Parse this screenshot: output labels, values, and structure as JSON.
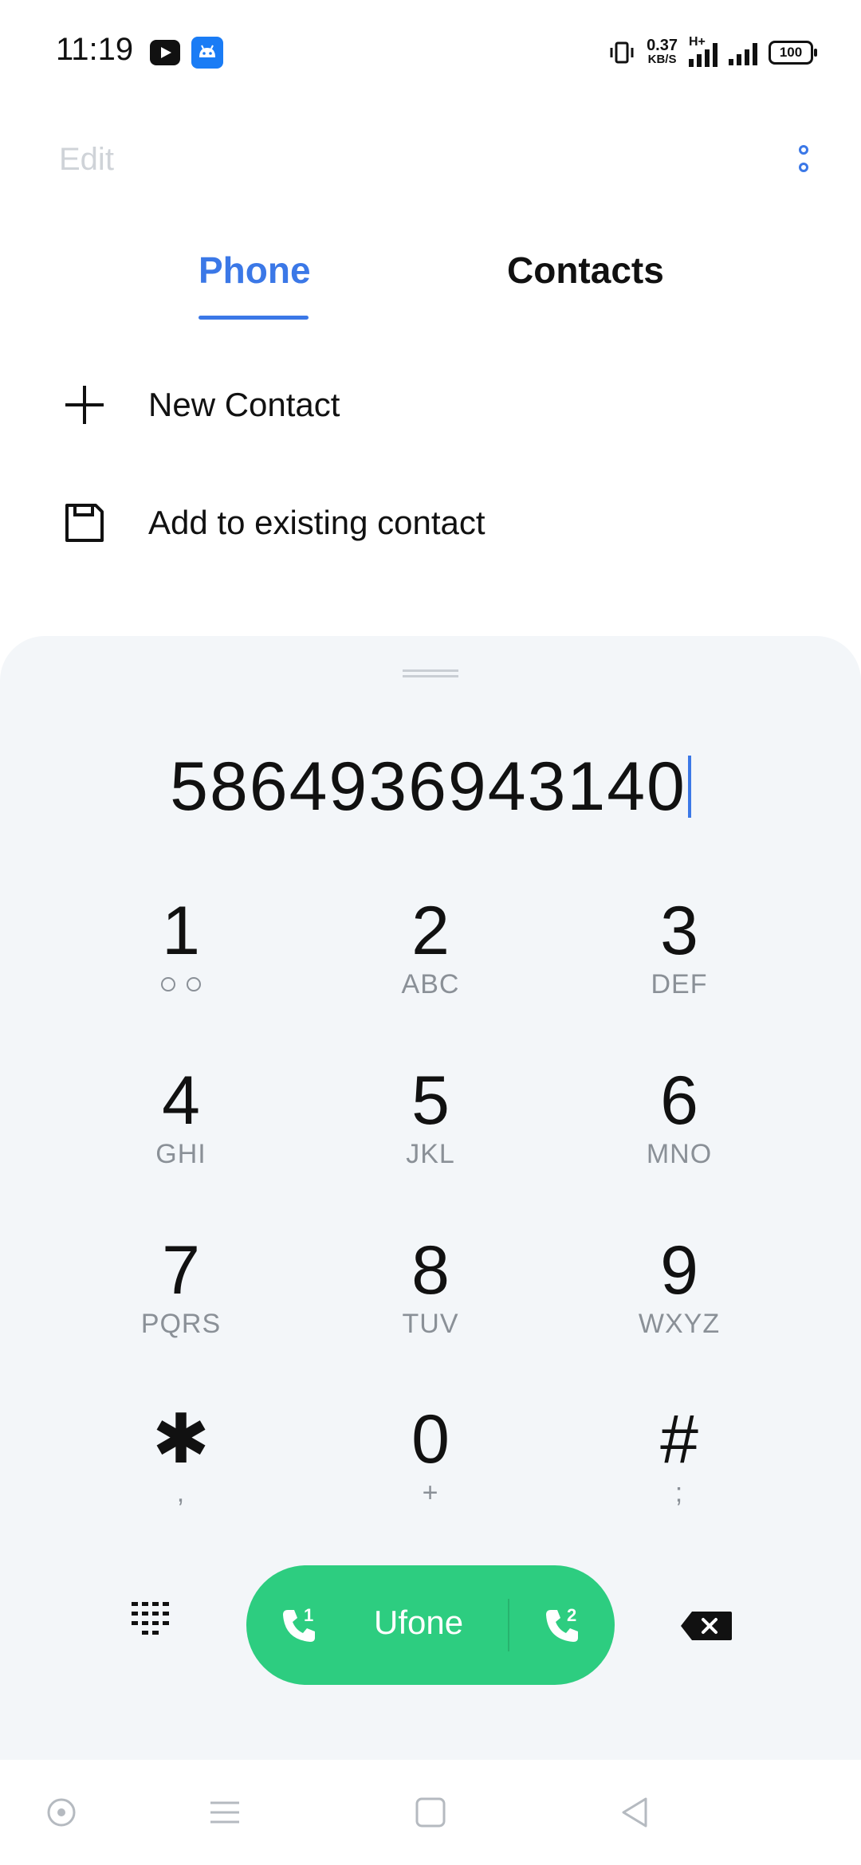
{
  "status_bar": {
    "time": "11:19",
    "speed_value": "0.37",
    "speed_unit": "KB/S",
    "network": "H+",
    "battery": "100",
    "app_icons": [
      "youtube-icon",
      "android-icon"
    ]
  },
  "header": {
    "edit_label": "Edit",
    "more_icon": "more-vertical-icon"
  },
  "tabs": [
    {
      "label": "Phone",
      "active": true
    },
    {
      "label": "Contacts",
      "active": false
    }
  ],
  "actions": [
    {
      "label": "New Contact",
      "icon": "plus-icon"
    },
    {
      "label": "Add to existing contact",
      "icon": "save-icon"
    }
  ],
  "dialer": {
    "number": "5864936943140",
    "keys": [
      {
        "digit": "1",
        "sub": ""
      },
      {
        "digit": "2",
        "sub": "ABC"
      },
      {
        "digit": "3",
        "sub": "DEF"
      },
      {
        "digit": "4",
        "sub": "GHI"
      },
      {
        "digit": "5",
        "sub": "JKL"
      },
      {
        "digit": "6",
        "sub": "MNO"
      },
      {
        "digit": "7",
        "sub": "PQRS"
      },
      {
        "digit": "8",
        "sub": "TUV"
      },
      {
        "digit": "9",
        "sub": "WXYZ"
      },
      {
        "digit": "✱",
        "sub": ","
      },
      {
        "digit": "0",
        "sub": "+"
      },
      {
        "digit": "#",
        "sub": ";"
      }
    ],
    "call": {
      "carrier": "Ufone",
      "sim1_label": "1",
      "sim2_label": "2"
    }
  },
  "colors": {
    "accent": "#3b78e7",
    "call_green": "#2dcd80",
    "panel_bg": "#f3f6f9"
  }
}
